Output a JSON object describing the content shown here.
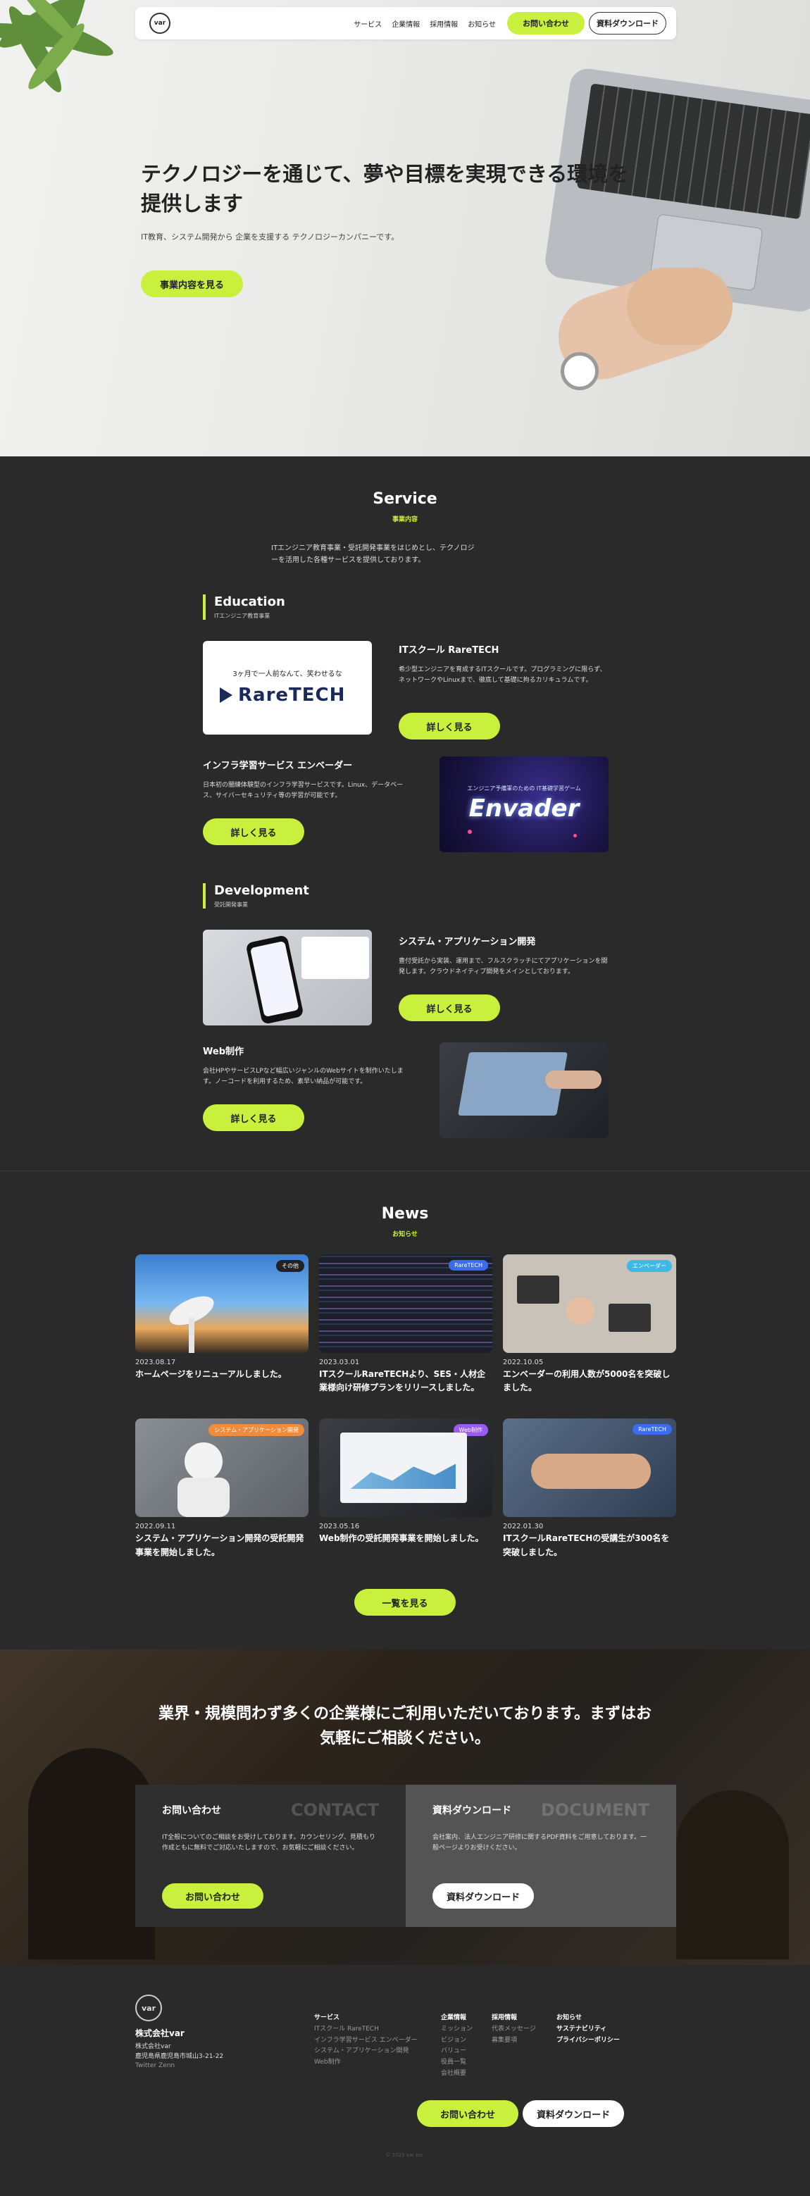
{
  "nav": {
    "logo": "var",
    "links": [
      "サービス",
      "企業情報",
      "採用情報",
      "お知らせ"
    ],
    "contact": "お問い合わせ",
    "download": "資料ダウンロード"
  },
  "hero": {
    "title": "テクノロジーを通じて、夢や目標を実現できる環境を提供します",
    "subtitle": "IT教育、システム開発から 企業を支援する テクノロジーカンパニーです。",
    "button": "事業内容を見る"
  },
  "service": {
    "title": "Service",
    "subtitle": "事業内容",
    "intro": "ITエンジニア教育事業・受託開発事業をはじめとし、テクノロジーを活用した各種サービスを提供しております。",
    "categories": [
      {
        "title": "Education",
        "subtitle": "ITエンジニア教育事業"
      },
      {
        "title": "Development",
        "subtitle": "受託開発事業"
      }
    ],
    "items": [
      {
        "title": "ITスクール RareTECH",
        "desc": "希少型エンジニアを育成するITスクールです。プログラミングに限らず、ネットワークやLinuxまで、徹底して基礎に拘るカリキュラムです。",
        "button": "詳しく見る",
        "img_caption": "3ヶ月で一人前なんて、笑わせるな",
        "img_brand": "RareTECH"
      },
      {
        "title": "インフラ学習サービス エンベーダー",
        "desc": "日本初の闇練体験型のインフラ学習サービスです。Linux、データベース、サイバーセキュリティ等の学習が可能です。",
        "button": "詳しく見る",
        "img_caption": "エンジニア予備軍のための IT基礎学習ゲーム",
        "img_brand": "Envader"
      },
      {
        "title": "システム・アプリケーション開発",
        "desc": "豊付受託から実装、運用まで、フルスクラッチにてアプリケーションを開発します。クラウドネイティブ開発をメインとしております。",
        "button": "詳しく見る"
      },
      {
        "title": "Web制作",
        "desc": "会社HPやサービスLPなど幅広いジャンルのWebサイトを制作いたします。ノーコードを利用するため、素早い納品が可能です。",
        "button": "詳しく見る"
      }
    ]
  },
  "news": {
    "title": "News",
    "subtitle": "お知らせ",
    "button": "一覧を見る",
    "items": [
      {
        "tag": "その他",
        "tag_color": "#222222",
        "date": "2023.08.17",
        "title": "ホームページをリニューアルしました。"
      },
      {
        "tag": "RareTECH",
        "tag_color": "#3b6cf0",
        "date": "2023.03.01",
        "title": "ITスクールRareTECHより、SES・人材企業様向け研修プランをリリースしました。"
      },
      {
        "tag": "エンベーダー",
        "tag_color": "#3fb8e8",
        "date": "2022.10.05",
        "title": "エンベーダーの利用人数が5000名を突破しました。"
      },
      {
        "tag": "システム・アプリケーション開発",
        "tag_color": "#f08c3b",
        "date": "2022.09.11",
        "title": "システム・アプリケーション開発の受託開発事業を開始しました。"
      },
      {
        "tag": "Web制作",
        "tag_color": "#9a5cf0",
        "date": "2023.05.16",
        "title": "Web制作の受託開発事業を開始しました。"
      },
      {
        "tag": "RareTECH",
        "tag_color": "#3b6cf0",
        "date": "2022.01.30",
        "title": "ITスクールRareTECHの受講生が300名を突破しました。"
      }
    ]
  },
  "contact": {
    "title": "業界・規模問わず多くの企業様にご利用いただいております。まずはお気軽にご相談ください。",
    "inquiry": {
      "heading": "お問い合わせ",
      "en": "CONTACT",
      "text": "IT全般についてのご相談をお受けしております。カウンセリング、見積もり作成ともに無料でご対応いたしますので、お気軽にご相談ください。",
      "button": "お問い合わせ"
    },
    "document": {
      "heading": "資料ダウンロード",
      "en": "DOCUMENT",
      "text": "会社案内、法人エンジニア研修に関するPDF資料をご用意しております。一般ページよりお受けください。",
      "button": "資料ダウンロード"
    }
  },
  "footer": {
    "logo": "var",
    "company": "株式会社var",
    "address_line1": "株式会社var",
    "address_line2": "鹿児島県鹿児島市城山3-21-22",
    "social": "Twitter  Zenn",
    "col_service": {
      "heading": "サービス",
      "items": [
        "ITスクール RareTECH",
        "インフラ学習サービス エンベーダー",
        "システム・アプリケーション開発",
        "Web制作"
      ]
    },
    "col_company": {
      "heading": "企業情報",
      "items": [
        "ミッション",
        "ビジョン",
        "バリュー",
        "役員一覧",
        "会社概要"
      ]
    },
    "col_recruit": {
      "heading": "採用情報",
      "items": [
        "代表メッセージ",
        "募集要項"
      ]
    },
    "col_news": {
      "heading": "お知らせ",
      "items": [
        "サステナビリティ",
        "プライバシーポリシー"
      ]
    },
    "contact": "お問い合わせ",
    "download": "資料ダウンロード",
    "copyright": "© 2023 var Inc."
  }
}
